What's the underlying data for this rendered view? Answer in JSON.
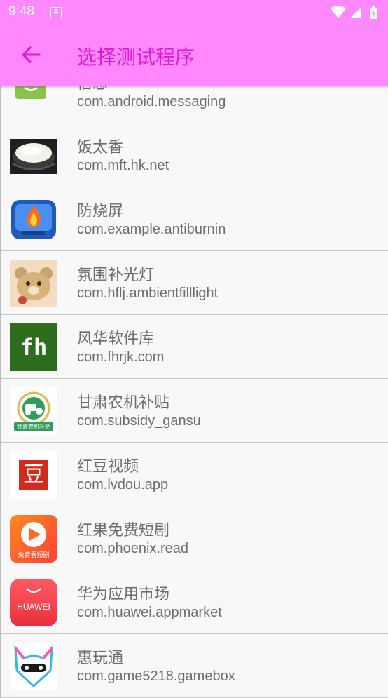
{
  "status_bar": {
    "time": "9:48",
    "notification_icon": "a-icon",
    "icons": [
      "wifi-icon",
      "signal-icon",
      "battery-icon"
    ]
  },
  "toolbar": {
    "back_icon": "arrow-left-icon",
    "title": "选择测试程序"
  },
  "colors": {
    "appbar_bg": "#ff88ff",
    "title": "#e01ad6",
    "back_arrow": "#e01ad6",
    "text": "#6c6c6c",
    "divider": "#c7c7c7"
  },
  "apps": [
    {
      "name": "信息",
      "package": "com.android.messaging",
      "icon": "messaging-icon"
    },
    {
      "name": "饭太香",
      "package": "com.mft.hk.net",
      "icon": "rice-bowl-icon"
    },
    {
      "name": "防烧屏",
      "package": "com.example.antiburnin",
      "icon": "flame-screen-icon"
    },
    {
      "name": "氛围补光灯",
      "package": "com.hflj.ambientfilllight",
      "icon": "bear-icon"
    },
    {
      "name": "风华软件库",
      "package": "com.fhrjk.com",
      "icon": "fh-logo-icon"
    },
    {
      "name": "甘肃农机补贴",
      "package": "com.subsidy_gansu",
      "icon": "tractor-badge-icon"
    },
    {
      "name": "红豆视频",
      "package": "com.lvdou.app",
      "icon": "dou-character-icon"
    },
    {
      "name": "红果免费短剧",
      "package": "com.phoenix.read",
      "icon": "play-button-icon"
    },
    {
      "name": "华为应用市场",
      "package": "com.huawei.appmarket",
      "icon": "huawei-bag-icon"
    },
    {
      "name": "惠玩通",
      "package": "com.game5218.gamebox",
      "icon": "gamepad-cat-icon"
    }
  ],
  "icon_text": {
    "fh": "fh",
    "dou": "豆",
    "huawei": "HUAWEI",
    "subsidy": "甘肃农机补贴",
    "phoenix": "免费看短剧"
  }
}
